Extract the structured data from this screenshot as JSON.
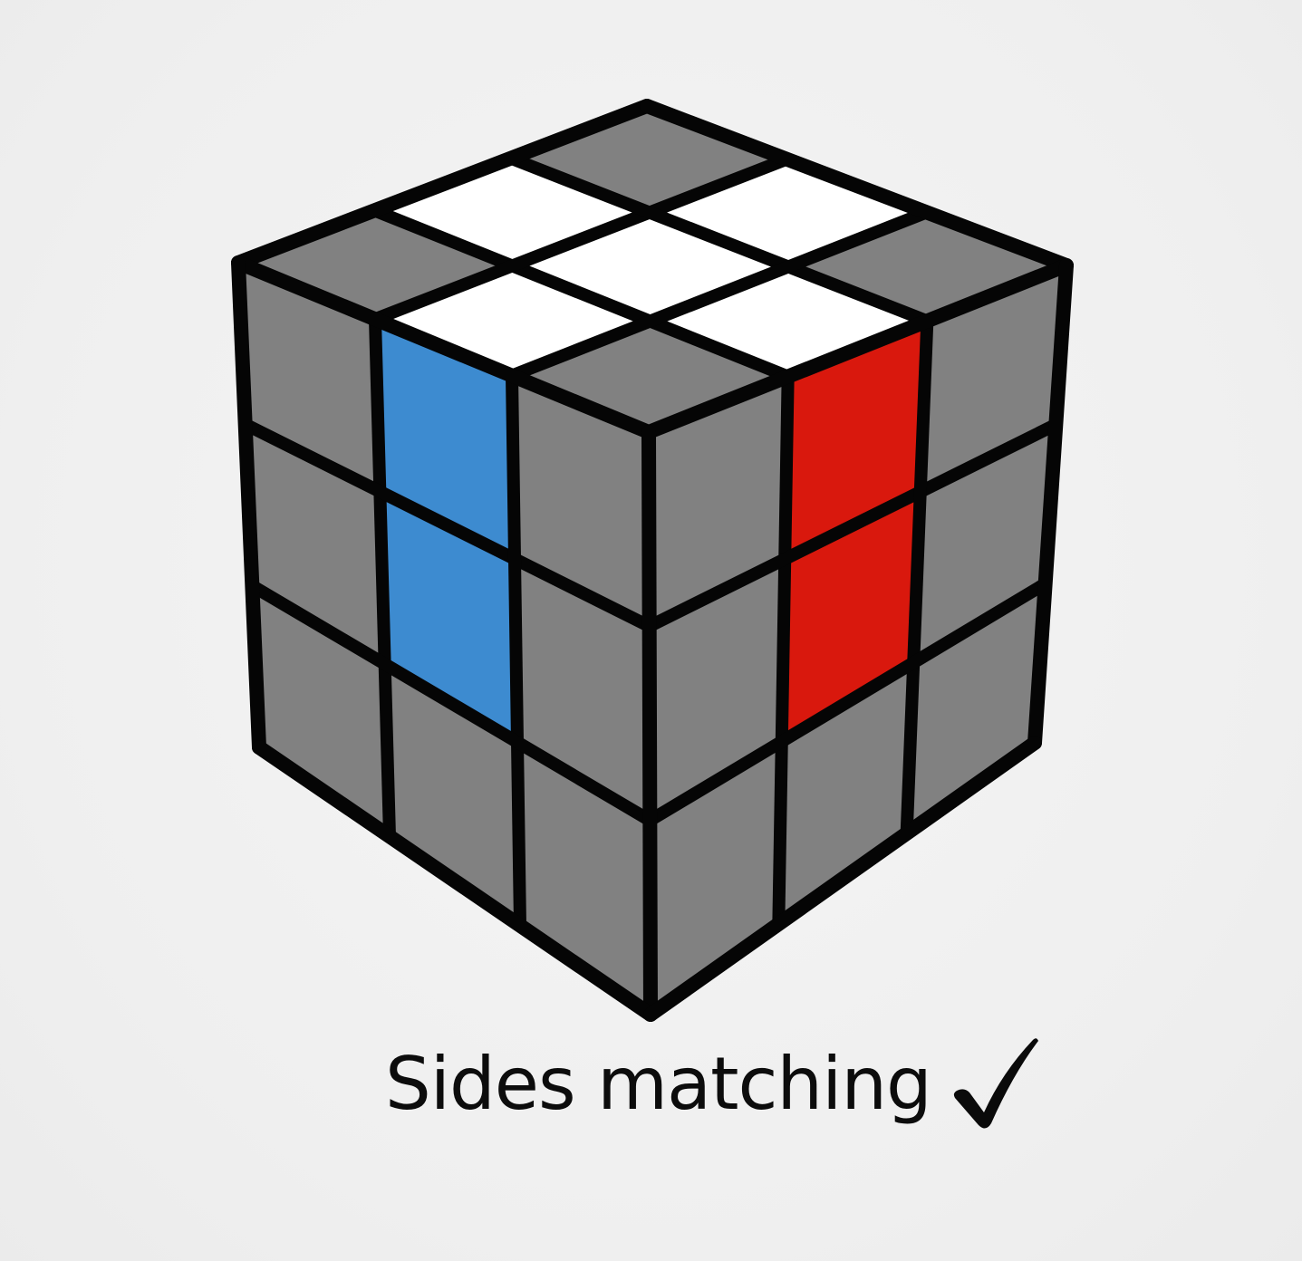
{
  "caption": {
    "text": "Sides matching",
    "icon": "check-mark-icon"
  },
  "cube": {
    "top": [
      [
        "grey",
        "white",
        "grey"
      ],
      [
        "white",
        "white",
        "white"
      ],
      [
        "grey",
        "white",
        "grey"
      ]
    ],
    "left": [
      [
        "grey",
        "blue",
        "grey"
      ],
      [
        "grey",
        "blue",
        "grey"
      ],
      [
        "grey",
        "grey",
        "grey"
      ]
    ],
    "right": [
      [
        "grey",
        "red",
        "grey"
      ],
      [
        "grey",
        "red",
        "grey"
      ],
      [
        "grey",
        "grey",
        "grey"
      ]
    ]
  },
  "colors": {
    "grey": "#818181",
    "white": "#ffffff",
    "blue": "#3d8bd0",
    "red": "#d9180d",
    "outline": "#050505",
    "background": "#f1f1f1"
  }
}
